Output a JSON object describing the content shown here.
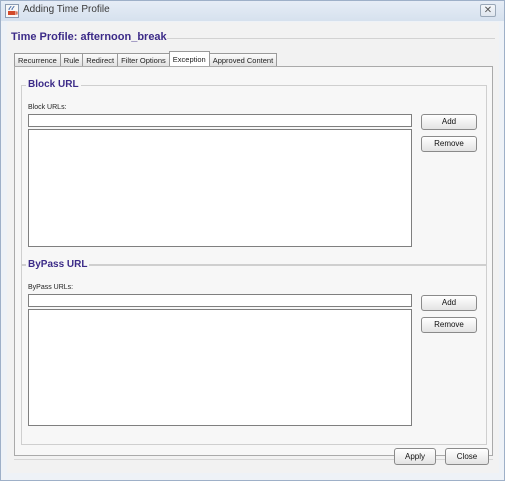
{
  "window": {
    "title": "Adding Time Profile",
    "close_glyph": "✕"
  },
  "profile": {
    "title": "Time Profile: afternoon_break"
  },
  "tabs": [
    {
      "label": "Recurrence",
      "active": false
    },
    {
      "label": "Rule",
      "active": false
    },
    {
      "label": "Redirect",
      "active": false
    },
    {
      "label": "Filter Options",
      "active": false
    },
    {
      "label": "Exception",
      "active": true
    },
    {
      "label": "Approved Content",
      "active": false
    }
  ],
  "block_url": {
    "title": "Block URL",
    "label": "Block URLs:",
    "input_value": "",
    "add_label": "Add",
    "remove_label": "Remove"
  },
  "bypass_url": {
    "title": "ByPass URL",
    "label": "ByPass URLs:",
    "input_value": "",
    "add_label": "Add",
    "remove_label": "Remove"
  },
  "footer": {
    "apply_label": "Apply",
    "close_label": "Close"
  },
  "colors": {
    "accent_title": "#3c2b88",
    "window_border": "#9eb0c8"
  }
}
